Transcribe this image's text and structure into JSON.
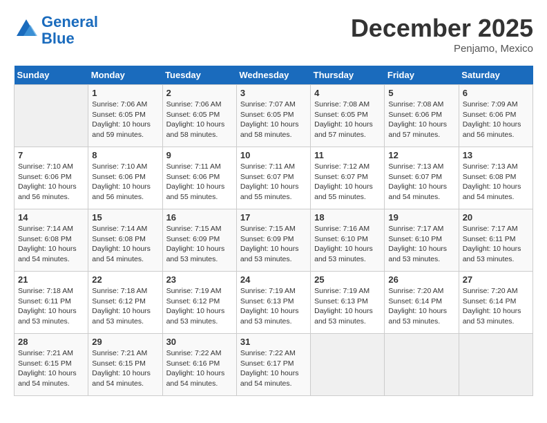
{
  "header": {
    "logo_line1": "General",
    "logo_line2": "Blue",
    "month": "December 2025",
    "location": "Penjamo, Mexico"
  },
  "weekdays": [
    "Sunday",
    "Monday",
    "Tuesday",
    "Wednesday",
    "Thursday",
    "Friday",
    "Saturday"
  ],
  "weeks": [
    [
      {
        "day": "",
        "info": ""
      },
      {
        "day": "1",
        "info": "Sunrise: 7:06 AM\nSunset: 6:05 PM\nDaylight: 10 hours\nand 59 minutes."
      },
      {
        "day": "2",
        "info": "Sunrise: 7:06 AM\nSunset: 6:05 PM\nDaylight: 10 hours\nand 58 minutes."
      },
      {
        "day": "3",
        "info": "Sunrise: 7:07 AM\nSunset: 6:05 PM\nDaylight: 10 hours\nand 58 minutes."
      },
      {
        "day": "4",
        "info": "Sunrise: 7:08 AM\nSunset: 6:05 PM\nDaylight: 10 hours\nand 57 minutes."
      },
      {
        "day": "5",
        "info": "Sunrise: 7:08 AM\nSunset: 6:06 PM\nDaylight: 10 hours\nand 57 minutes."
      },
      {
        "day": "6",
        "info": "Sunrise: 7:09 AM\nSunset: 6:06 PM\nDaylight: 10 hours\nand 56 minutes."
      }
    ],
    [
      {
        "day": "7",
        "info": "Sunrise: 7:10 AM\nSunset: 6:06 PM\nDaylight: 10 hours\nand 56 minutes."
      },
      {
        "day": "8",
        "info": "Sunrise: 7:10 AM\nSunset: 6:06 PM\nDaylight: 10 hours\nand 56 minutes."
      },
      {
        "day": "9",
        "info": "Sunrise: 7:11 AM\nSunset: 6:06 PM\nDaylight: 10 hours\nand 55 minutes."
      },
      {
        "day": "10",
        "info": "Sunrise: 7:11 AM\nSunset: 6:07 PM\nDaylight: 10 hours\nand 55 minutes."
      },
      {
        "day": "11",
        "info": "Sunrise: 7:12 AM\nSunset: 6:07 PM\nDaylight: 10 hours\nand 55 minutes."
      },
      {
        "day": "12",
        "info": "Sunrise: 7:13 AM\nSunset: 6:07 PM\nDaylight: 10 hours\nand 54 minutes."
      },
      {
        "day": "13",
        "info": "Sunrise: 7:13 AM\nSunset: 6:08 PM\nDaylight: 10 hours\nand 54 minutes."
      }
    ],
    [
      {
        "day": "14",
        "info": "Sunrise: 7:14 AM\nSunset: 6:08 PM\nDaylight: 10 hours\nand 54 minutes."
      },
      {
        "day": "15",
        "info": "Sunrise: 7:14 AM\nSunset: 6:08 PM\nDaylight: 10 hours\nand 54 minutes."
      },
      {
        "day": "16",
        "info": "Sunrise: 7:15 AM\nSunset: 6:09 PM\nDaylight: 10 hours\nand 53 minutes."
      },
      {
        "day": "17",
        "info": "Sunrise: 7:15 AM\nSunset: 6:09 PM\nDaylight: 10 hours\nand 53 minutes."
      },
      {
        "day": "18",
        "info": "Sunrise: 7:16 AM\nSunset: 6:10 PM\nDaylight: 10 hours\nand 53 minutes."
      },
      {
        "day": "19",
        "info": "Sunrise: 7:17 AM\nSunset: 6:10 PM\nDaylight: 10 hours\nand 53 minutes."
      },
      {
        "day": "20",
        "info": "Sunrise: 7:17 AM\nSunset: 6:11 PM\nDaylight: 10 hours\nand 53 minutes."
      }
    ],
    [
      {
        "day": "21",
        "info": "Sunrise: 7:18 AM\nSunset: 6:11 PM\nDaylight: 10 hours\nand 53 minutes."
      },
      {
        "day": "22",
        "info": "Sunrise: 7:18 AM\nSunset: 6:12 PM\nDaylight: 10 hours\nand 53 minutes."
      },
      {
        "day": "23",
        "info": "Sunrise: 7:19 AM\nSunset: 6:12 PM\nDaylight: 10 hours\nand 53 minutes."
      },
      {
        "day": "24",
        "info": "Sunrise: 7:19 AM\nSunset: 6:13 PM\nDaylight: 10 hours\nand 53 minutes."
      },
      {
        "day": "25",
        "info": "Sunrise: 7:19 AM\nSunset: 6:13 PM\nDaylight: 10 hours\nand 53 minutes."
      },
      {
        "day": "26",
        "info": "Sunrise: 7:20 AM\nSunset: 6:14 PM\nDaylight: 10 hours\nand 53 minutes."
      },
      {
        "day": "27",
        "info": "Sunrise: 7:20 AM\nSunset: 6:14 PM\nDaylight: 10 hours\nand 53 minutes."
      }
    ],
    [
      {
        "day": "28",
        "info": "Sunrise: 7:21 AM\nSunset: 6:15 PM\nDaylight: 10 hours\nand 54 minutes."
      },
      {
        "day": "29",
        "info": "Sunrise: 7:21 AM\nSunset: 6:15 PM\nDaylight: 10 hours\nand 54 minutes."
      },
      {
        "day": "30",
        "info": "Sunrise: 7:22 AM\nSunset: 6:16 PM\nDaylight: 10 hours\nand 54 minutes."
      },
      {
        "day": "31",
        "info": "Sunrise: 7:22 AM\nSunset: 6:17 PM\nDaylight: 10 hours\nand 54 minutes."
      },
      {
        "day": "",
        "info": ""
      },
      {
        "day": "",
        "info": ""
      },
      {
        "day": "",
        "info": ""
      }
    ]
  ]
}
